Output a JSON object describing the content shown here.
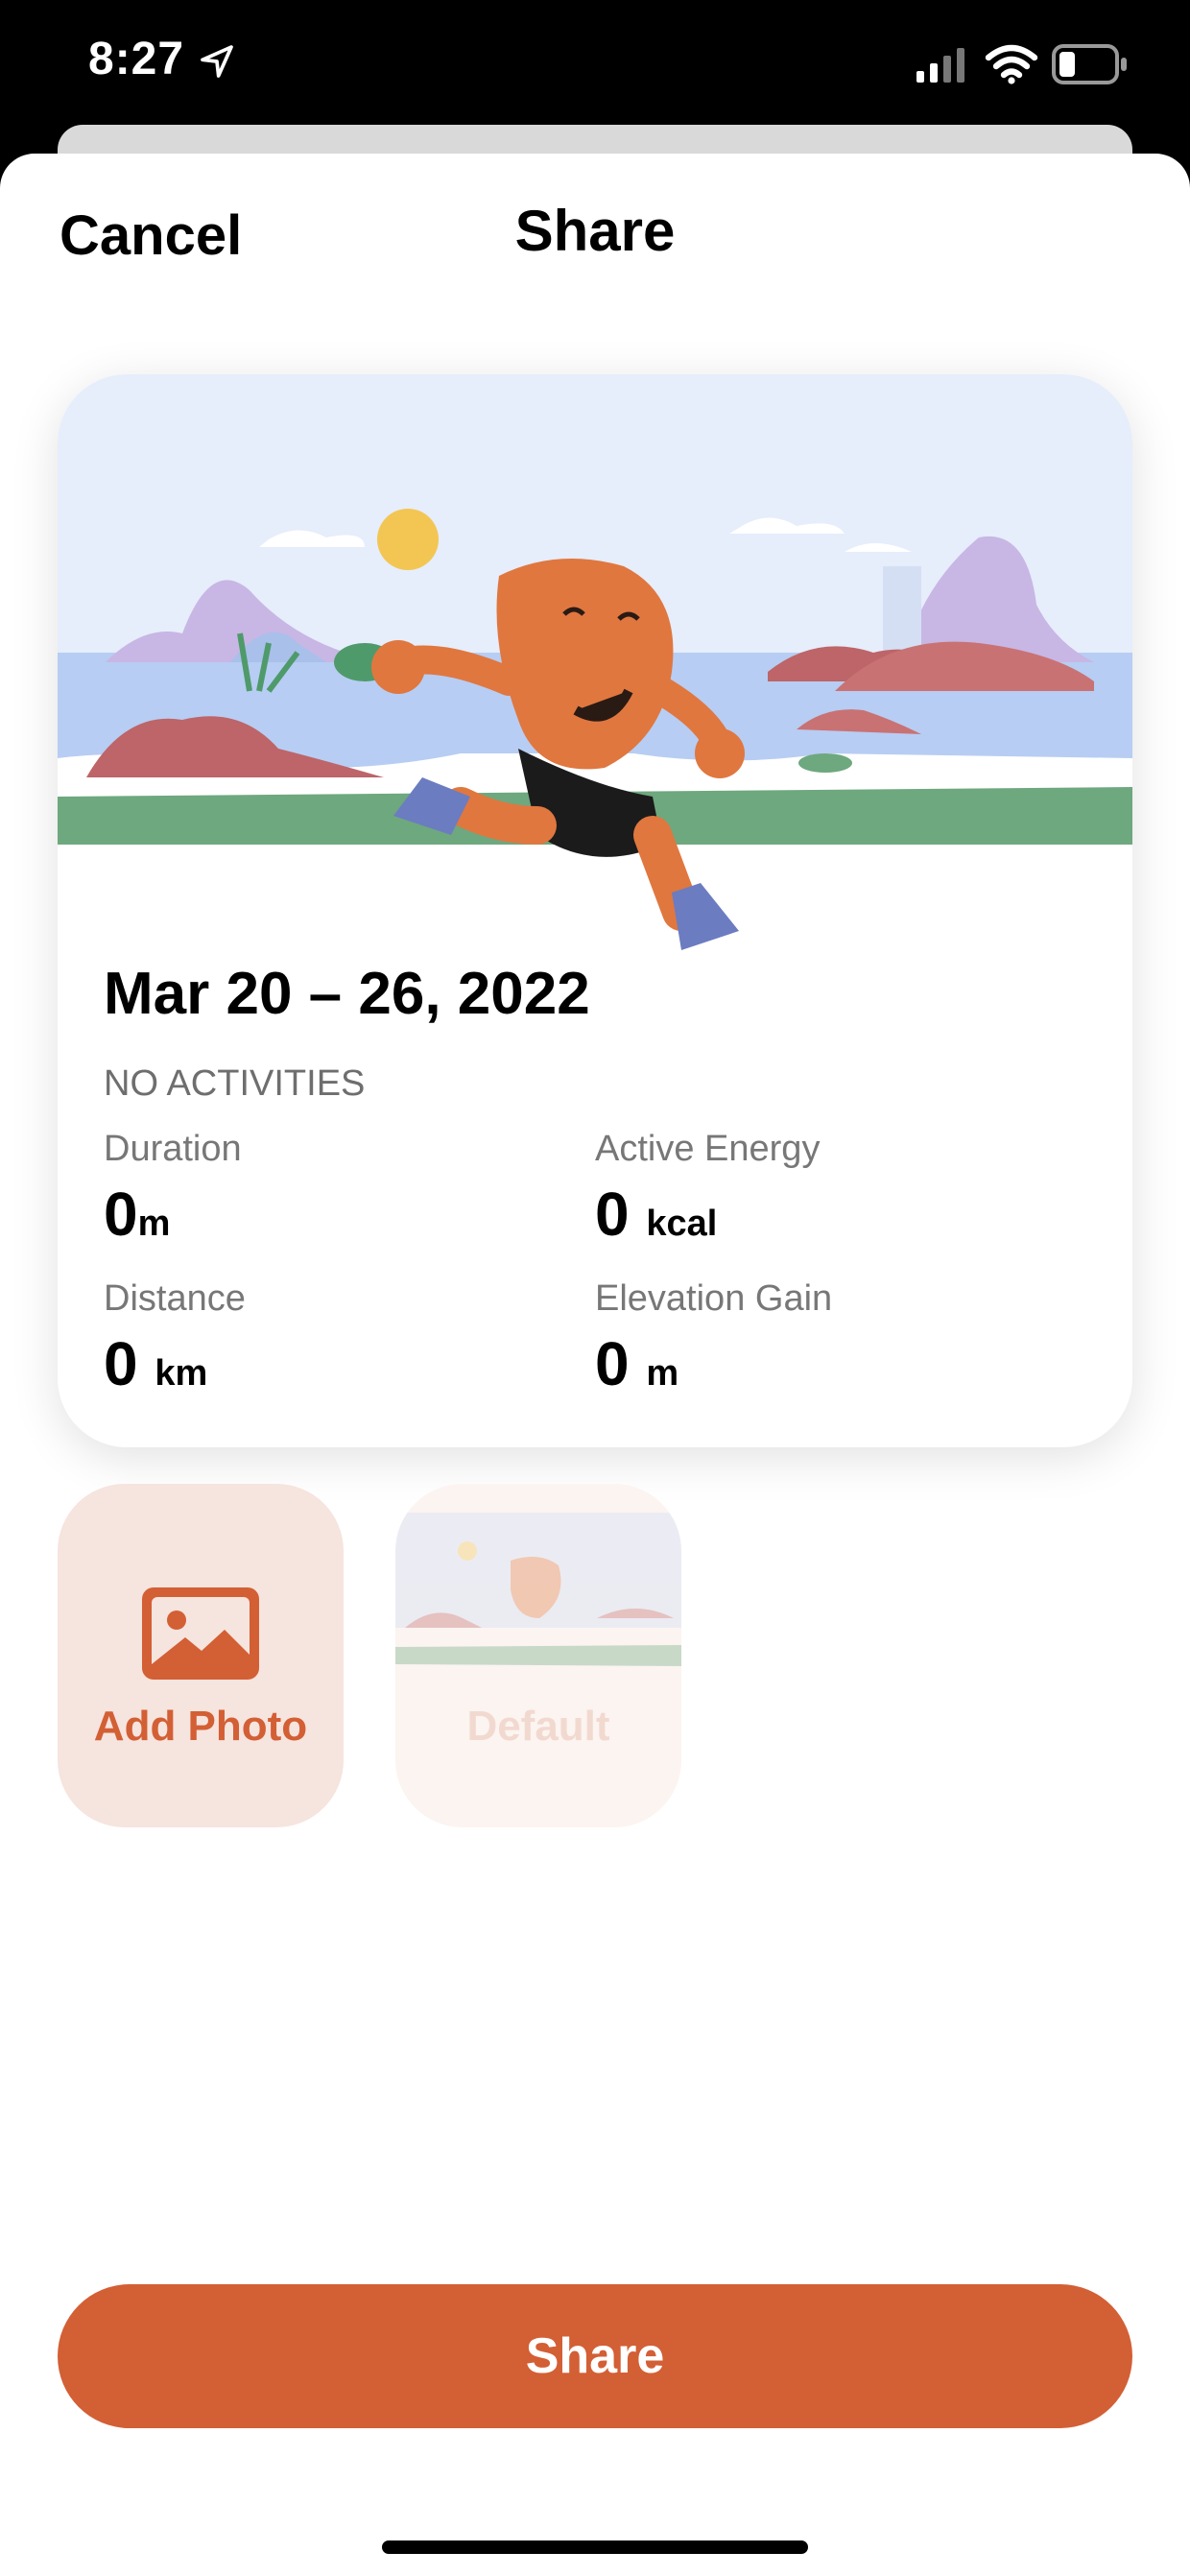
{
  "status_bar": {
    "time": "8:27",
    "icons": [
      "location-arrow-icon",
      "cellular-signal-icon",
      "wifi-icon",
      "battery-icon"
    ]
  },
  "header": {
    "cancel_label": "Cancel",
    "title": "Share"
  },
  "card": {
    "date_range": "Mar 20 – 26, 2022",
    "subtitle": "NO ACTIVITIES",
    "stats": [
      {
        "label": "Duration",
        "value": "0",
        "unit": "m"
      },
      {
        "label": "Active Energy",
        "value": "0",
        "unit": "kcal"
      },
      {
        "label": "Distance",
        "value": "0",
        "unit": "km"
      },
      {
        "label": "Elevation Gain",
        "value": "0",
        "unit": "m"
      }
    ]
  },
  "tiles": {
    "add_photo_label": "Add Photo",
    "default_label": "Default"
  },
  "share_button_label": "Share",
  "colors": {
    "accent": "#d35f35",
    "tile_add_bg": "#f6e4de",
    "card_bg": "#ffffff"
  }
}
